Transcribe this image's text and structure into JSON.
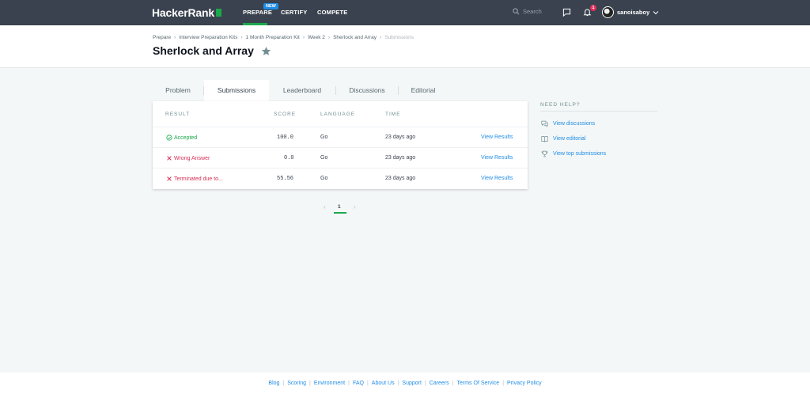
{
  "nav": {
    "logo": "HackerRank",
    "links": [
      "PREPARE",
      "CERTIFY",
      "COMPETE"
    ],
    "new_badge": "NEW",
    "search_placeholder": "Search",
    "notification_count": "1",
    "username": "sanoisaboy"
  },
  "breadcrumb": [
    "Prepare",
    "Interview Preparation Kits",
    "1 Month Preparation Kit",
    "Week 2",
    "Sherlock and Array",
    "Submissions"
  ],
  "title": "Sherlock and Array",
  "tabs": [
    "Problem",
    "Submissions",
    "Leaderboard",
    "Discussions",
    "Editorial"
  ],
  "active_tab": "Submissions",
  "table": {
    "headers": [
      "RESULT",
      "SCORE",
      "LANGUAGE",
      "TIME"
    ],
    "rows": [
      {
        "result": "Accepted",
        "score": "100.0",
        "language": "Go",
        "time": "23 days ago",
        "action": "View Results",
        "status": "ok"
      },
      {
        "result": "Wrong Answer",
        "score": "0.0",
        "language": "Go",
        "time": "23 days ago",
        "action": "View Results",
        "status": "bad"
      },
      {
        "result": "Terminated due to...",
        "score": "55.56",
        "language": "Go",
        "time": "23 days ago",
        "action": "View Results",
        "status": "bad"
      }
    ]
  },
  "pagination": {
    "current": "1",
    "prev": "‹",
    "next": "›"
  },
  "help": {
    "title": "NEED HELP?",
    "links": [
      "View discussions",
      "View editorial",
      "View top submissions"
    ]
  },
  "footer": [
    "Blog",
    "Scoring",
    "Environment",
    "FAQ",
    "About Us",
    "Support",
    "Careers",
    "Terms Of Service",
    "Privacy Policy"
  ],
  "colors": {
    "nav_bg": "#39424e",
    "accent_green": "#1ba94c",
    "link_blue": "#1f8ce6",
    "error_red": "#d72f55",
    "page_bg": "#f3f7f7"
  }
}
